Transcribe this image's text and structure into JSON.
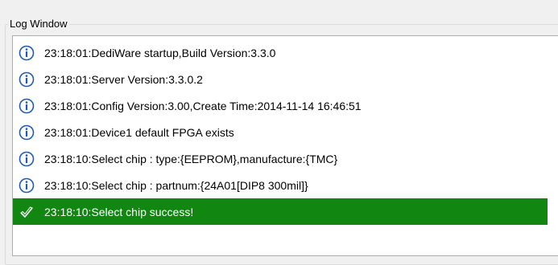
{
  "group": {
    "title": "Log Window"
  },
  "log": {
    "entries": [
      {
        "icon": "info-icon",
        "text": "23:18:01:DediWare startup,Build Version:3.3.0"
      },
      {
        "icon": "info-icon",
        "text": "23:18:01:Server Version:3.3.0.2"
      },
      {
        "icon": "info-icon",
        "text": "23:18:01:Config Version:3.00,Create Time:2014-11-14 16:46:51"
      },
      {
        "icon": "info-icon",
        "text": "23:18:01:Device1 default FPGA exists"
      },
      {
        "icon": "info-icon",
        "text": "23:18:10:Select chip : type:{EEPROM},manufacture:{TMC}"
      },
      {
        "icon": "info-icon",
        "text": "23:18:10:Select chip : partnum:{24A01[DIP8 300mil]}"
      },
      {
        "icon": "success-check-icon",
        "text": "23:18:10:Select chip success!",
        "selected": true
      }
    ]
  },
  "colors": {
    "selected_row": "#118611",
    "info_icon": "#1f5bb5"
  }
}
